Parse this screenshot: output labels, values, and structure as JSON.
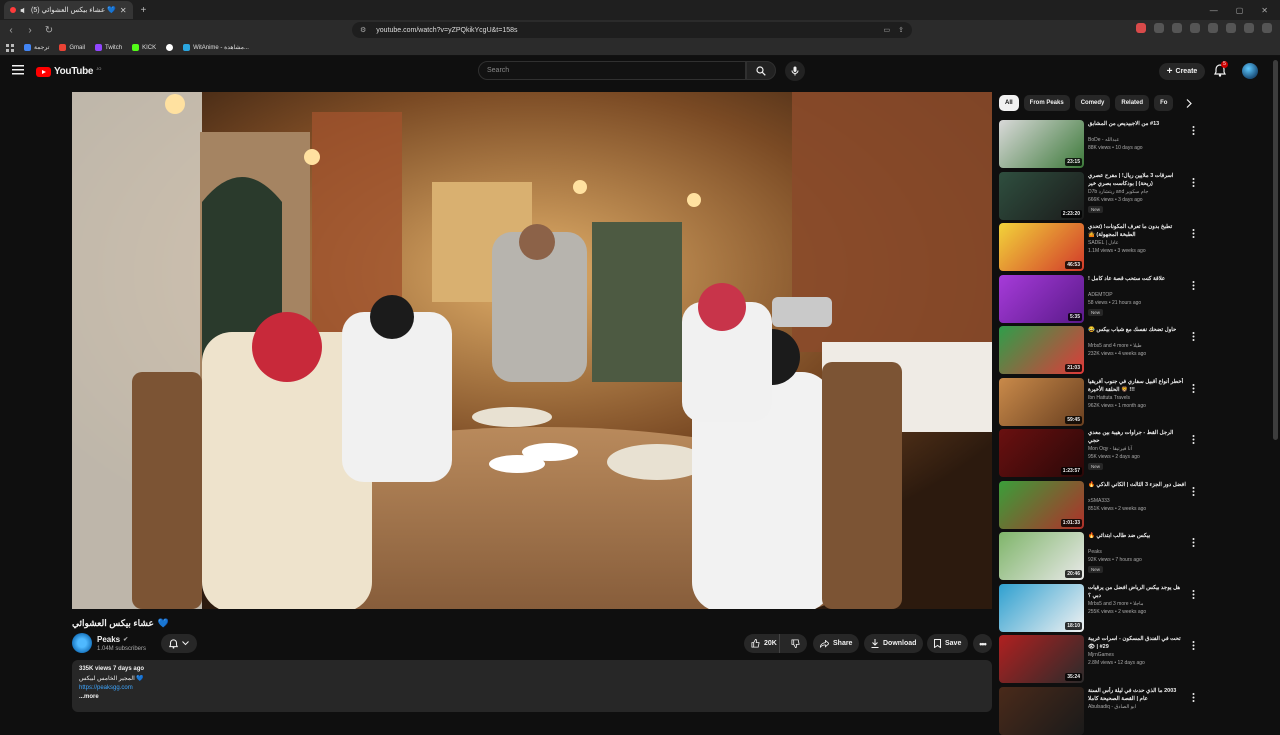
{
  "browser": {
    "tab_title": "(5) عشاء بيكس العشوائي 💙",
    "url": "youtube.com/watch?v=yZPQkikYcgU&t=158s",
    "bookmarks": [
      {
        "label": "ترجمة",
        "color": "#4285f4"
      },
      {
        "label": "Gmail",
        "color": "#ea4335"
      },
      {
        "label": "Twitch",
        "color": "#9146ff"
      },
      {
        "label": "KICK",
        "color": "#53fc18"
      },
      {
        "label": "",
        "color": "#ffffff"
      },
      {
        "label": "WitAnime - مشاهدة...",
        "color": "#2aa6e0"
      }
    ]
  },
  "youtube": {
    "logo_text": "YouTube",
    "logo_sup": "JO",
    "search_placeholder": "Search",
    "create_label": "Create",
    "notification_count": "5"
  },
  "video": {
    "title": "عشاء بيكس العشوائي",
    "title_emoji": "💙",
    "channel": "Peaks",
    "subscribers": "1.04M subscribers",
    "likes": "20K",
    "share_label": "Share",
    "download_label": "Download",
    "save_label": "Save",
    "description": {
      "stats": "335K views  7 days ago",
      "line1": "المجير الخامس لبيكس 💙",
      "link": "https://peaksgg.com",
      "more": "...more"
    }
  },
  "chips": [
    "All",
    "From Peaks",
    "Comedy",
    "Related",
    "Fo"
  ],
  "recommendations": [
    {
      "title": "#13 من الاجبيديص من المشابق",
      "channel": "BoDe - عبدالله",
      "meta": "88K views • 10 days ago",
      "duration": "23:15",
      "new": "",
      "thumb": [
        "#d9d9d9",
        "#3d7a3a"
      ]
    },
    {
      "title": "اسرقات 3 ملايين ريال! | مفرح عصري (ريحة) | بودكاست بصري خير",
      "channel": "D7b ريتشارد and جام سكوير",
      "meta": "666K views • 3 days ago",
      "duration": "2:23:20",
      "new": "New",
      "thumb": [
        "#2f4f3f",
        "#1b1b1b"
      ]
    },
    {
      "title": "تطبخ بدون ما تعرف المكونات! (تحدي الطبخة المجهولة) 🤷",
      "channel": "SADEL | عادل",
      "meta": "1.1M views • 3 weeks ago",
      "duration": "46:53",
      "new": "",
      "thumb": [
        "#f2d33a",
        "#d23a2a"
      ]
    },
    {
      "title": "علاقة كنت ستحب قصة عاد كامل !",
      "channel": "ADEMTOP",
      "meta": "58 views • 21 hours ago",
      "duration": "5:35",
      "new": "New",
      "thumb": [
        "#a63bd9",
        "#5a1a8a"
      ]
    },
    {
      "title": "حاول تضحك نفسك مع شباب بيكس 😂",
      "channel": "Mrbs5 and 4 more • طيلا",
      "meta": "232K views • 4 weeks ago",
      "duration": "21:03",
      "new": "",
      "thumb": [
        "#2e9e4a",
        "#e03a3a"
      ]
    },
    {
      "title": "أخطر أنواع أقبيل سفاري في جنوب أفريقيا !!! 🦁 الحلقة الأخيرة",
      "channel": "Ibn Hattuta Travels",
      "meta": "962K views • 1 month ago",
      "duration": "59:45",
      "new": "",
      "thumb": [
        "#c98a4a",
        "#6a4020"
      ]
    },
    {
      "title": "الرجل القط - جراوات رهيبة بين معدي حجي",
      "channel": "Mon Oqy - آنا فيرتيقا",
      "meta": "95K views • 2 days ago",
      "duration": "1:23:57",
      "new": "New",
      "thumb": [
        "#6a1010",
        "#2a0808"
      ]
    },
    {
      "title": "افضل دور الجزء 3 الثالث | الكاني الذكي 🔥",
      "channel": "xSMA333",
      "meta": "851K views • 2 weeks ago",
      "duration": "1:01:33",
      "new": "",
      "thumb": [
        "#3a9e3a",
        "#b0302a"
      ]
    },
    {
      "title": "بيكس ضد طالب ابتدائي 🔥",
      "channel": "Peaks",
      "meta": "92K views • 7 hours ago",
      "duration": "20:46",
      "new": "New",
      "thumb": [
        "#7fb56a",
        "#e9e9e9"
      ]
    },
    {
      "title": "هل يوجد بيكس الرياض افضل من يرقيات دبي ؟",
      "channel": "Mrbs5 and 3 more • ماجلا",
      "meta": "255K views • 2 weeks ago",
      "duration": "18:10",
      "new": "",
      "thumb": [
        "#2fa0d0",
        "#f2f2f2"
      ]
    },
    {
      "title": "تحت في الفندق المسكون - اسرات غريبة 29# | 👁",
      "channel": "MjrnGames",
      "meta": "2.8M views • 12 days ago",
      "duration": "35:24",
      "new": "",
      "thumb": [
        "#b02020",
        "#2b2b2b"
      ]
    },
    {
      "title": "2003 ما الذي حدث في ليلة رأس السنة عام | القصة الصحيحة كاملا",
      "channel": "Abulsadiq - ابو الصادق",
      "meta": "",
      "duration": "",
      "new": "",
      "thumb": [
        "#4a2a1a",
        "#1a1a1a"
      ]
    }
  ],
  "colors": {
    "accent": "#ff0000",
    "link": "#3ea6ff",
    "surface": "#272727",
    "background": "#0f0f0f"
  }
}
